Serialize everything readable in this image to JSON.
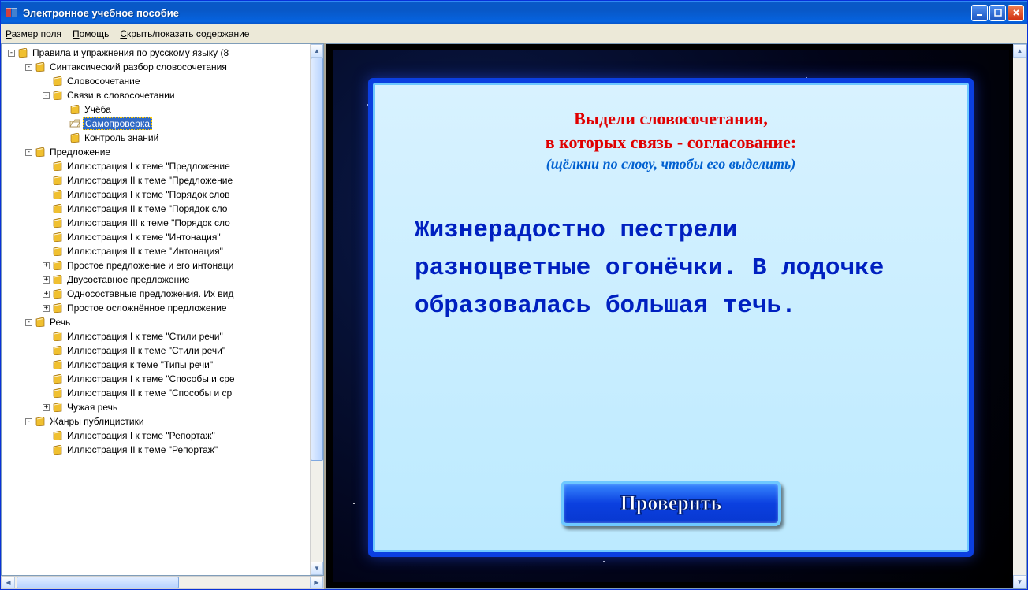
{
  "window": {
    "title": "Электронное учебное пособие"
  },
  "menu": {
    "item1": "Размер поля",
    "item1_u": "Р",
    "item2": "Помощь",
    "item2_u": "П",
    "item3": "Скрыть/показать содержание",
    "item3_u": "С"
  },
  "tree": [
    {
      "depth": 0,
      "exp": "-",
      "icon": "book",
      "label": "Правила и упражнения по русскому языку (8"
    },
    {
      "depth": 1,
      "exp": "-",
      "icon": "book",
      "label": "Синтаксический разбор словосочетания"
    },
    {
      "depth": 2,
      "exp": "",
      "icon": "book",
      "label": "Словосочетание"
    },
    {
      "depth": 2,
      "exp": "-",
      "icon": "book",
      "label": "Связи в словосочетании"
    },
    {
      "depth": 3,
      "exp": "",
      "icon": "book",
      "label": "Учёба"
    },
    {
      "depth": 3,
      "exp": "",
      "icon": "open",
      "label": "Самопроверка",
      "selected": true
    },
    {
      "depth": 3,
      "exp": "",
      "icon": "book",
      "label": "Контроль знаний"
    },
    {
      "depth": 1,
      "exp": "-",
      "icon": "book",
      "label": "Предложение"
    },
    {
      "depth": 2,
      "exp": "",
      "icon": "book",
      "label": "Иллюстрация I к теме \"Предложение"
    },
    {
      "depth": 2,
      "exp": "",
      "icon": "book",
      "label": "Иллюстрация II к теме \"Предложение"
    },
    {
      "depth": 2,
      "exp": "",
      "icon": "book",
      "label": "Иллюстрация I к теме \"Порядок слов"
    },
    {
      "depth": 2,
      "exp": "",
      "icon": "book",
      "label": "Иллюстрация II к теме \"Порядок сло"
    },
    {
      "depth": 2,
      "exp": "",
      "icon": "book",
      "label": "Иллюстрация III к теме \"Порядок сло"
    },
    {
      "depth": 2,
      "exp": "",
      "icon": "book",
      "label": "Иллюстрация I к теме \"Интонация\""
    },
    {
      "depth": 2,
      "exp": "",
      "icon": "book",
      "label": "Иллюстрация II к теме \"Интонация\""
    },
    {
      "depth": 2,
      "exp": "+",
      "icon": "book",
      "label": "Простое предложение и его интонаци"
    },
    {
      "depth": 2,
      "exp": "+",
      "icon": "book",
      "label": "Двусоставное предложение"
    },
    {
      "depth": 2,
      "exp": "+",
      "icon": "book",
      "label": "Односоставные предложения. Их вид"
    },
    {
      "depth": 2,
      "exp": "+",
      "icon": "book",
      "label": "Простое осложнённое предложение"
    },
    {
      "depth": 1,
      "exp": "-",
      "icon": "book",
      "label": "Речь"
    },
    {
      "depth": 2,
      "exp": "",
      "icon": "book",
      "label": "Иллюстрация I к теме \"Стили речи\""
    },
    {
      "depth": 2,
      "exp": "",
      "icon": "book",
      "label": "Иллюстрация II к теме \"Стили речи\""
    },
    {
      "depth": 2,
      "exp": "",
      "icon": "book",
      "label": "Иллюстрация к теме \"Типы речи\""
    },
    {
      "depth": 2,
      "exp": "",
      "icon": "book",
      "label": "Иллюстрация I к теме \"Способы и сре"
    },
    {
      "depth": 2,
      "exp": "",
      "icon": "book",
      "label": "Иллюстрация II к теме \"Способы и ср"
    },
    {
      "depth": 2,
      "exp": "+",
      "icon": "book",
      "label": "Чужая речь"
    },
    {
      "depth": 1,
      "exp": "-",
      "icon": "book",
      "label": "Жанры публицистики"
    },
    {
      "depth": 2,
      "exp": "",
      "icon": "book",
      "label": "Иллюстрация I к теме \"Репортаж\""
    },
    {
      "depth": 2,
      "exp": "",
      "icon": "book",
      "label": "Иллюстрация II к теме \"Репортаж\""
    }
  ],
  "content": {
    "prompt1": "Выдели словосочетания,",
    "prompt2": "в которых связь - согласование:",
    "hint": "(щёлкни по слову, чтобы его выделить)",
    "text": "Жизнерадостно пестрели разноцветные огонёчки. В лодочке образовалась большая течь.",
    "check": "Проверить"
  }
}
